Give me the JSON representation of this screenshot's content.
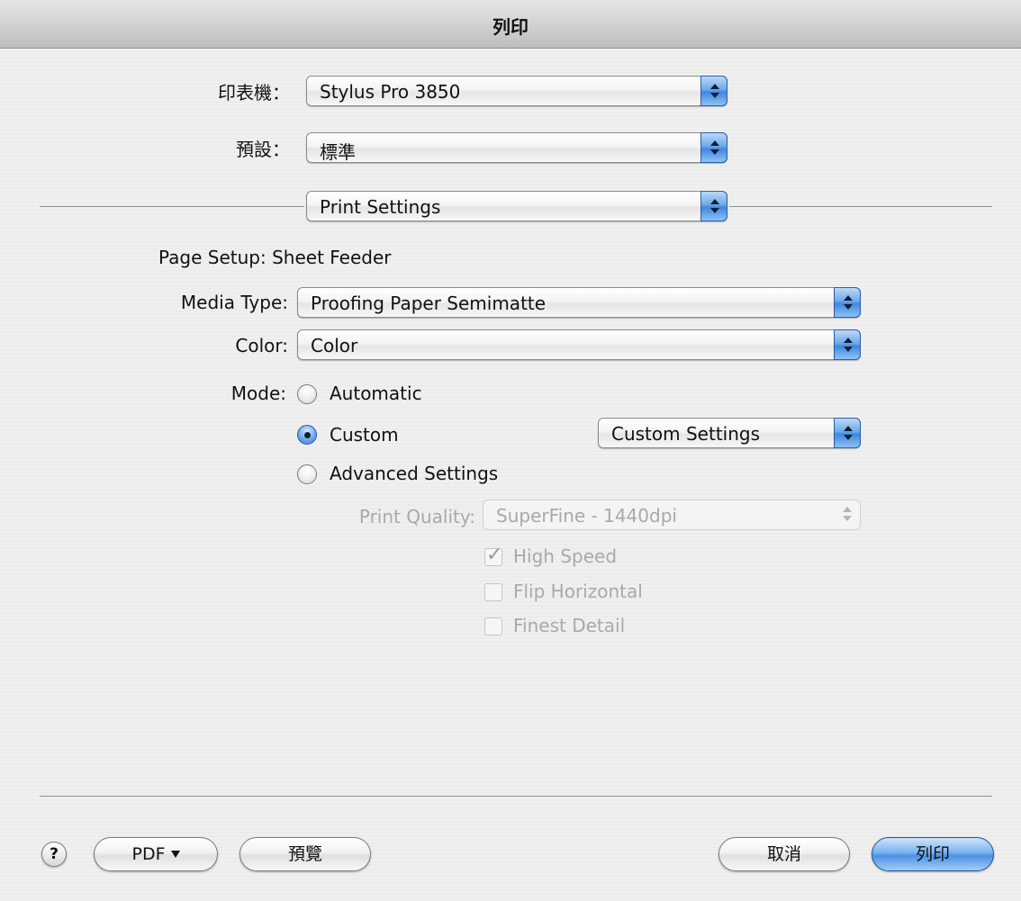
{
  "window": {
    "title": "列印"
  },
  "printer": {
    "label": "印表機：",
    "value": "Stylus Pro 3850"
  },
  "presets": {
    "label": "預設：",
    "value": "標準"
  },
  "panel": {
    "value": "Print Settings"
  },
  "page_setup": {
    "label": "Page Setup:",
    "value": "Sheet Feeder"
  },
  "media_type": {
    "label": "Media Type:",
    "value": "Proofing Paper Semimatte"
  },
  "color": {
    "label": "Color:",
    "value": "Color"
  },
  "mode": {
    "label": "Mode:",
    "options": [
      {
        "label": "Automatic",
        "selected": false
      },
      {
        "label": "Custom",
        "selected": true
      },
      {
        "label": "Advanced Settings",
        "selected": false
      }
    ],
    "custom_settings": "Custom Settings"
  },
  "print_quality": {
    "label": "Print Quality:",
    "value": "SuperFine - 1440dpi",
    "enabled": false
  },
  "checkboxes": [
    {
      "label": "High Speed",
      "checked": true,
      "enabled": false
    },
    {
      "label": "Flip Horizontal",
      "checked": false,
      "enabled": false
    },
    {
      "label": "Finest Detail",
      "checked": false,
      "enabled": false
    }
  ],
  "footer": {
    "help": "?",
    "pdf": "PDF",
    "preview": "預覽",
    "cancel": "取消",
    "print": "列印"
  },
  "colors": {
    "accent": "#4b92e4",
    "disabled_text": "#a9a9a9"
  }
}
